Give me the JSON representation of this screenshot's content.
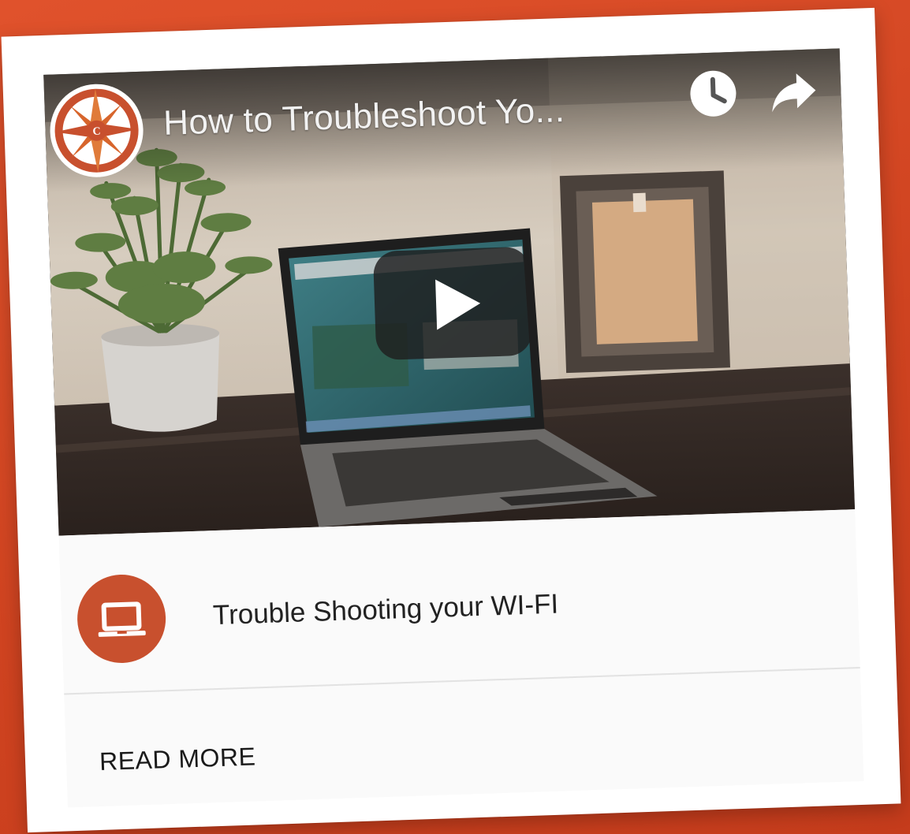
{
  "video": {
    "title": "How to Troubleshoot Yo...",
    "logo_icon": "compass-logo-icon",
    "logo_letter": "C",
    "watch_later_icon": "clock-icon",
    "share_icon": "share-arrow-icon",
    "play_icon": "play-icon"
  },
  "post": {
    "icon": "laptop-icon",
    "title": "Trouble Shooting your WI-FI",
    "read_more": "READ MORE"
  },
  "colors": {
    "background": "#d94a26",
    "card": "#ffffff",
    "accent": "#c8502e"
  }
}
